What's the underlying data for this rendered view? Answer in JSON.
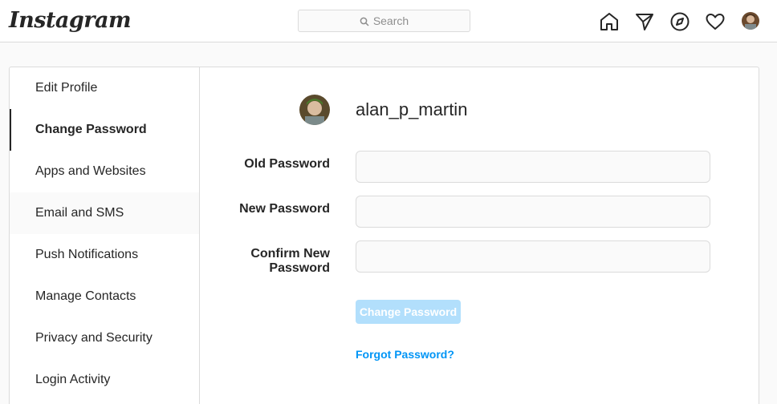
{
  "header": {
    "logo": "Instagram",
    "search_placeholder": "Search",
    "nav_icons": [
      "home-icon",
      "direct-message-icon",
      "explore-icon",
      "activity-heart-icon",
      "profile-avatar"
    ]
  },
  "sidebar": {
    "items": [
      {
        "label": "Edit Profile"
      },
      {
        "label": "Change Password"
      },
      {
        "label": "Apps and Websites"
      },
      {
        "label": "Email and SMS"
      },
      {
        "label": "Push Notifications"
      },
      {
        "label": "Manage Contacts"
      },
      {
        "label": "Privacy and Security"
      },
      {
        "label": "Login Activity"
      }
    ],
    "active": "Change Password"
  },
  "form": {
    "username": "alan_p_martin",
    "old_password_label": "Old Password",
    "new_password_label": "New Password",
    "confirm_label_line1": "Confirm New",
    "confirm_label_line2": "Password",
    "submit_label": "Change Password",
    "forgot_label": "Forgot Password?"
  },
  "colors": {
    "accent": "#0095f6",
    "button_disabled": "#b2dffc",
    "border": "#dbdbdb",
    "background": "#fafafa"
  }
}
